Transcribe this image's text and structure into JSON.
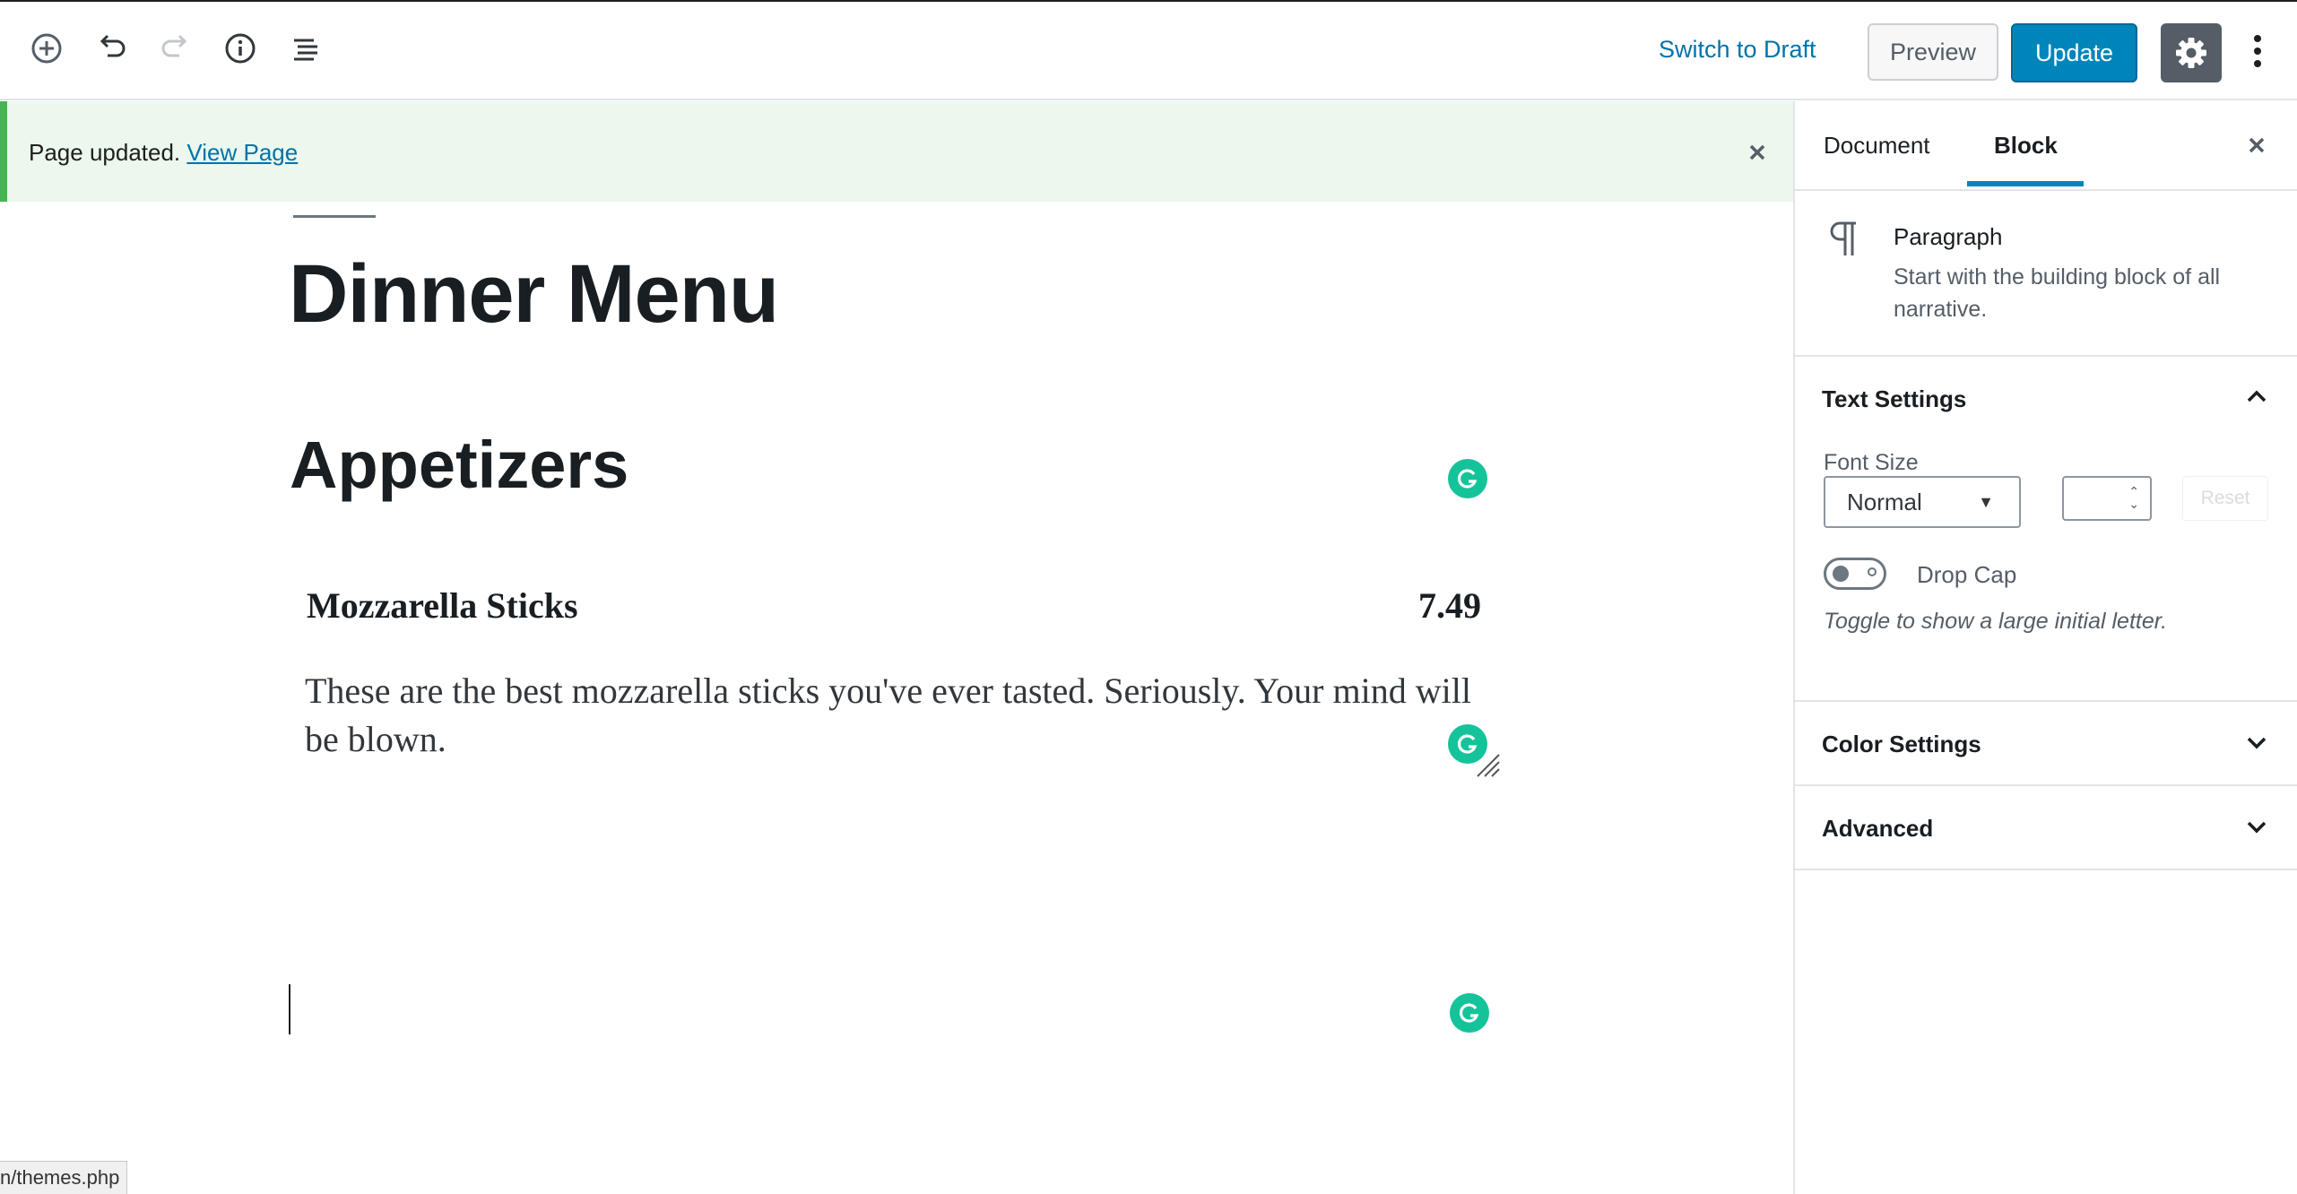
{
  "toolbar": {
    "add_block_icon": "plus-circle-icon",
    "undo_icon": "undo-icon",
    "redo_icon": "redo-icon",
    "info_icon": "info-icon",
    "outline_icon": "list-outline-icon",
    "switch_to_draft": "Switch to Draft",
    "preview": "Preview",
    "update": "Update",
    "settings_icon": "gear-icon",
    "more_icon": "more-vertical-icon"
  },
  "notice": {
    "text": "Page updated.",
    "link": "View Page"
  },
  "editor": {
    "title": "Dinner Menu",
    "heading": "Appetizers",
    "menu_item": {
      "name": "Mozzarella Sticks",
      "price": "7.49",
      "description": "These are the best mozzarella sticks you've ever tasted. Seriously. Your mind will be blown."
    }
  },
  "status_bar": {
    "url": "n/themes.php"
  },
  "sidebar": {
    "tabs": [
      {
        "label": "Document"
      },
      {
        "label": "Block"
      }
    ],
    "active_tab": "Block",
    "block": {
      "name": "Paragraph",
      "description": "Start with the building block of all narrative."
    },
    "text_settings": {
      "title": "Text Settings",
      "font_size_label": "Font Size",
      "font_size_value": "Normal",
      "custom_size_value": "",
      "reset": "Reset",
      "drop_cap_label": "Drop Cap",
      "drop_cap_enabled": false,
      "drop_cap_help": "Toggle to show a large initial letter."
    },
    "color_settings": {
      "title": "Color Settings"
    },
    "advanced": {
      "title": "Advanced"
    }
  },
  "colors": {
    "accent": "#0085ba",
    "link": "#0073aa",
    "notice_bg": "#ecf7ed",
    "notice_border": "#46b450",
    "grammarly": "#15c39a"
  }
}
